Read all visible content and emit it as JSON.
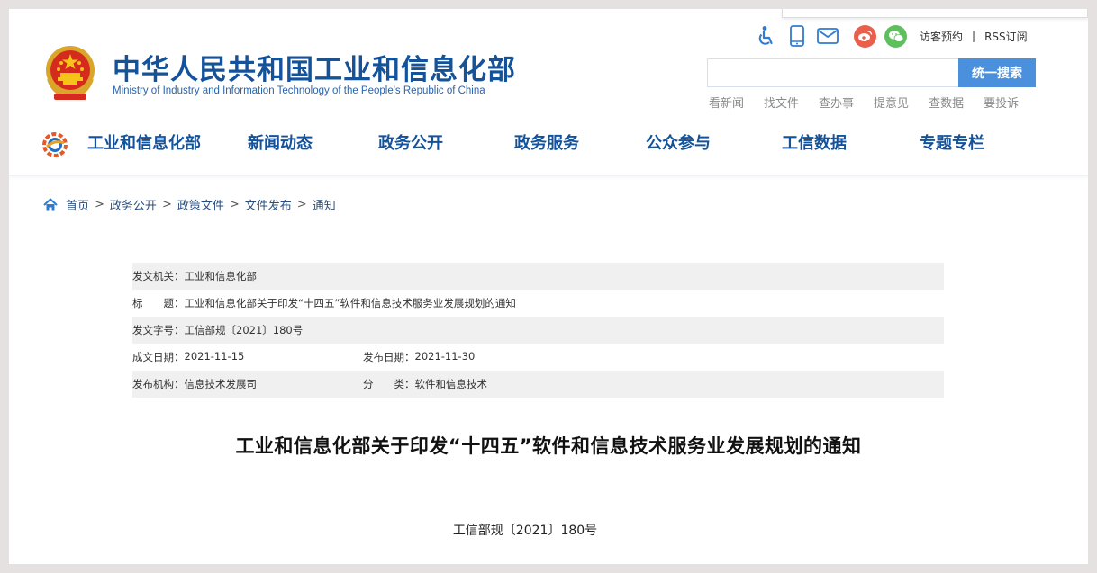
{
  "header": {
    "title": "中华人民共和国工业和信息化部",
    "subtitle": "Ministry of Industry and Information Technology of the People's Republic of China",
    "utility": {
      "visit_label": "访客预约",
      "separator": "|",
      "rss_label": "RSS订阅"
    },
    "search": {
      "input_value": "",
      "placeholder": "",
      "button_label": "统一搜索"
    },
    "quick_links": [
      "看新闻",
      "找文件",
      "查办事",
      "提意见",
      "查数据",
      "要投诉"
    ]
  },
  "nav": {
    "items": [
      "工业和信息化部",
      "新闻动态",
      "政务公开",
      "政务服务",
      "公众参与",
      "工信数据",
      "专题专栏"
    ]
  },
  "breadcrumb": {
    "items": [
      "首页",
      "政务公开",
      "政策文件",
      "文件发布",
      "通知"
    ],
    "separator": ">"
  },
  "info": {
    "issuer_label": "发文机关：",
    "issuer_value": "工业和信息化部",
    "title_label": "标　　题：",
    "title_value": "工业和信息化部关于印发“十四五”软件和信息技术服务业发展规划的通知",
    "docno_label": "发文字号：",
    "docno_value": "工信部规〔2021〕180号",
    "written_label": "成文日期：",
    "written_value": "2021-11-15",
    "published_label": "发布日期：",
    "published_value": "2021-11-30",
    "org_label": "发布机构：",
    "org_value": "信息技术发展司",
    "category_label": "分　　类：",
    "category_value": "软件和信息技术"
  },
  "article": {
    "title": "工业和信息化部关于印发“十四五”软件和信息技术服务业发展规划的通知",
    "doc_number": "工信部规〔2021〕180号"
  },
  "colors": {
    "brand_blue": "#14529a",
    "search_button": "#4a90dc",
    "weibo_red": "#e8604c",
    "wechat_green": "#5fbf5f",
    "row_shade": "#f0f0f0"
  },
  "icons": [
    "accessibility-icon",
    "mobile-icon",
    "mail-icon",
    "weibo-icon",
    "wechat-icon",
    "home-icon"
  ]
}
